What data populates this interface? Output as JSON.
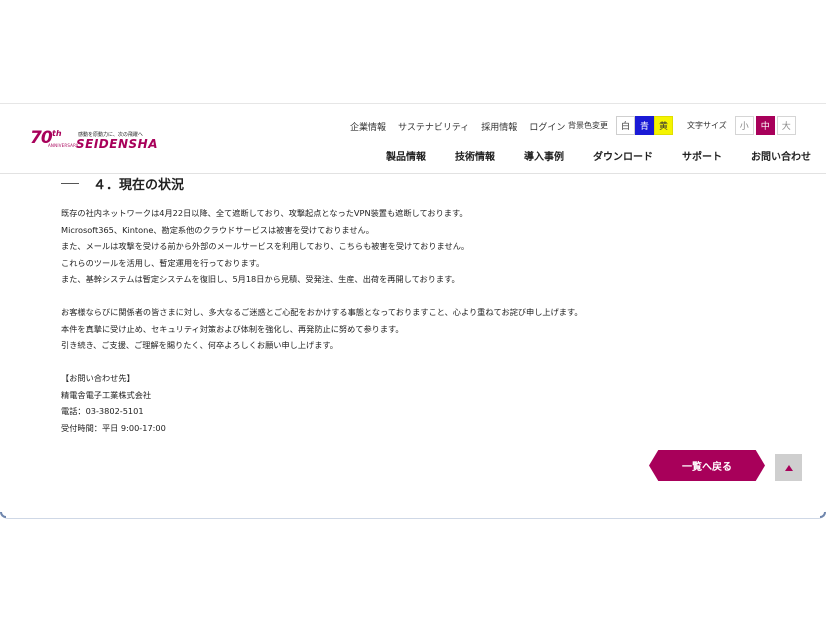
{
  "header": {
    "logo": {
      "anniversary_number": "70",
      "anniversary_suffix": "th",
      "anniversary_text": "ANNIVERSARY",
      "tagline": "感動を原動力に、次の飛躍へ",
      "company": "SEIDENSHA"
    },
    "top_links": [
      "企業情報",
      "サステナビリティ",
      "採用情報",
      "ログイン"
    ],
    "bg_color": {
      "label": "背景色変更",
      "options": [
        {
          "label": "白",
          "color": "#ffffff"
        },
        {
          "label": "青",
          "color": "#1a1ad6"
        },
        {
          "label": "黄",
          "color": "#f5f400"
        }
      ]
    },
    "font_size": {
      "label": "文字サイズ",
      "options": [
        "小",
        "中",
        "大"
      ],
      "selected": "中"
    },
    "main_nav": [
      "製品情報",
      "技術情報",
      "導入事例",
      "ダウンロード",
      "サポート",
      "お問い合わせ"
    ]
  },
  "content": {
    "section_title": "４．現在の状況",
    "paragraph1": [
      "既存の社内ネットワークは4月22日以降、全て遮断しており、攻撃起点となったVPN装置も遮断しております。",
      "Microsoft365、Kintone、勘定系他のクラウドサービスは被害を受けておりません。",
      "また、メールは攻撃を受ける前から外部のメールサービスを利用しており、こちらも被害を受けておりません。",
      "これらのツールを活用し、暫定運用を行っております。",
      "また、基幹システムは暫定システムを復旧し、5月18日から見積、受発注、生産、出荷を再開しております。"
    ],
    "paragraph2": [
      "お客様ならびに関係者の皆さまに対し、多大なるご迷惑とご心配をおかけする事態となっておりますこと、心より重ねてお詫び申し上げます。",
      "本件を真摯に受け止め、セキュリティ対策および体制を強化し、再発防止に努めて参ります。",
      "引き続き、ご支援、ご理解を賜りたく、何卒よろしくお願い申し上げます。"
    ],
    "contact": [
      "【お問い合わせ先】",
      "精電舎電子工業株式会社",
      "電話：03-3802-5101",
      "受付時間：平日 9:00-17:00"
    ],
    "back_button": "一覧へ戻る"
  },
  "colors": {
    "brand": "#a8005a"
  }
}
